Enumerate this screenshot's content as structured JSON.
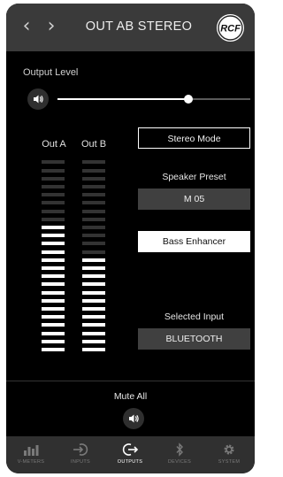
{
  "header": {
    "title": "OUT AB STEREO",
    "logo_text": "RCF"
  },
  "output": {
    "label": "Output Level",
    "level_fraction": 0.68
  },
  "meters": {
    "a": {
      "label": "Out A",
      "segments": 24,
      "lit": 16
    },
    "b": {
      "label": "Out B",
      "segments": 24,
      "lit": 12
    }
  },
  "controls": {
    "stereo_mode": "Stereo Mode",
    "speaker_preset_label": "Speaker Preset",
    "speaker_preset_value": "M 05",
    "bass_enhancer": "Bass Enhancer",
    "selected_input_label": "Selected Input",
    "selected_input_value": "BLUETOOTH"
  },
  "mute": {
    "label": "Mute All"
  },
  "tabs": [
    {
      "label": "V-METERS",
      "icon": "vmeters-icon"
    },
    {
      "label": "INPUTS",
      "icon": "inputs-icon"
    },
    {
      "label": "OUTPUTS",
      "icon": "outputs-icon",
      "active": true
    },
    {
      "label": "DEVICES",
      "icon": "bluetooth-icon"
    },
    {
      "label": "SYSTEM",
      "icon": "gear-icon"
    }
  ],
  "colors": {
    "header_bg": "#3a3a3a",
    "background": "#000000",
    "accent": "#ffffff",
    "control_grey": "#404040",
    "tab_inactive": "#7a7a7a"
  }
}
